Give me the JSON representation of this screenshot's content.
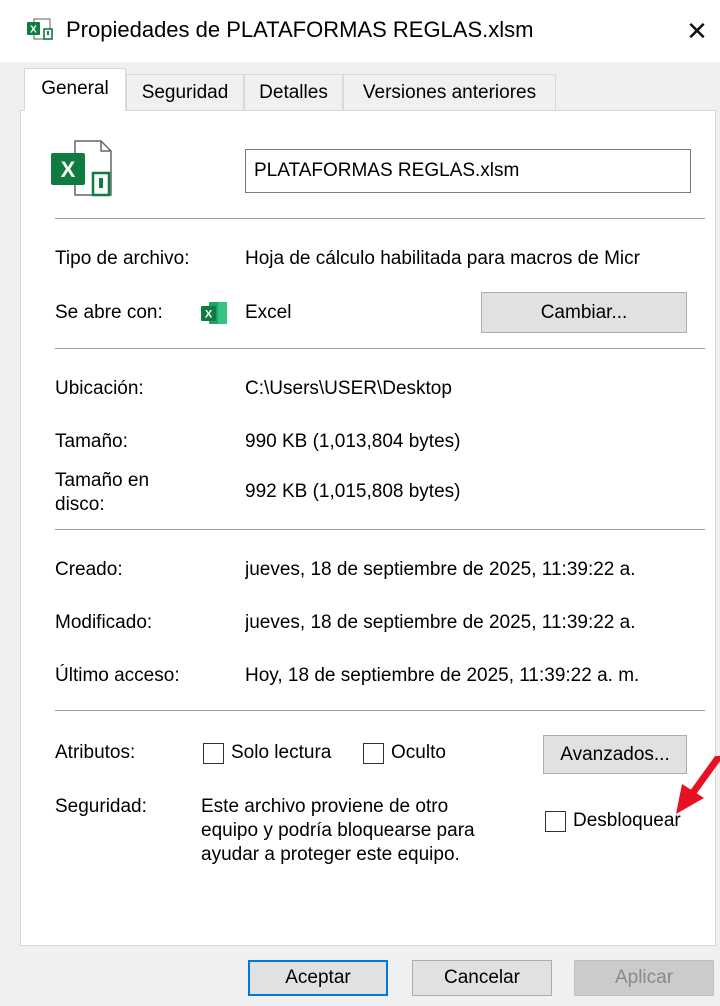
{
  "window": {
    "title": "Propiedades de PLATAFORMAS REGLAS.xlsm",
    "close_glyph": "✕"
  },
  "tabs": [
    {
      "label": "General",
      "active": true
    },
    {
      "label": "Seguridad",
      "active": false
    },
    {
      "label": "Detalles",
      "active": false
    },
    {
      "label": "Versiones anteriores",
      "active": false
    }
  ],
  "general": {
    "file_name": "PLATAFORMAS REGLAS.xlsm",
    "file_type_label": "Tipo de archivo:",
    "file_type_value": "Hoja de cálculo habilitada para macros de Micr",
    "opens_with_label": "Se abre con:",
    "opens_with_value": "Excel",
    "change_button": "Cambiar...",
    "location_label": "Ubicación:",
    "location_value": "C:\\Users\\USER\\Desktop",
    "size_label": "Tamaño:",
    "size_value": "990 KB (1,013,804 bytes)",
    "size_on_disk_label_1": "Tamaño en",
    "size_on_disk_label_2": "disco:",
    "size_on_disk_value": "992 KB (1,015,808 bytes)",
    "created_label": "Creado:",
    "created_value": "jueves, 18 de septiembre de 2025, 11:39:22 a.",
    "modified_label": "Modificado:",
    "modified_value": "jueves, 18 de septiembre de 2025, 11:39:22 a.",
    "accessed_label": "Último acceso:",
    "accessed_value": "Hoy, 18 de septiembre de 2025, 11:39:22 a. m.",
    "attributes_label": "Atributos:",
    "readonly_label": "Solo lectura",
    "hidden_label": "Oculto",
    "advanced_button": "Avanzados...",
    "security_label": "Seguridad:",
    "security_line_1": "Este archivo proviene de otro",
    "security_line_2": "equipo y podría bloquearse para",
    "security_line_3": "ayudar a proteger este equipo.",
    "unblock_label": "Desbloquear"
  },
  "footer": {
    "ok": "Aceptar",
    "cancel": "Cancelar",
    "apply": "Aplicar"
  },
  "colors": {
    "excel_green": "#107c41",
    "annotation_arrow": "#e81123",
    "focus_blue": "#0078d7"
  },
  "icons": [
    "excel-file-icon",
    "excel-app-icon",
    "close-icon",
    "red-arrow-annotation"
  ]
}
